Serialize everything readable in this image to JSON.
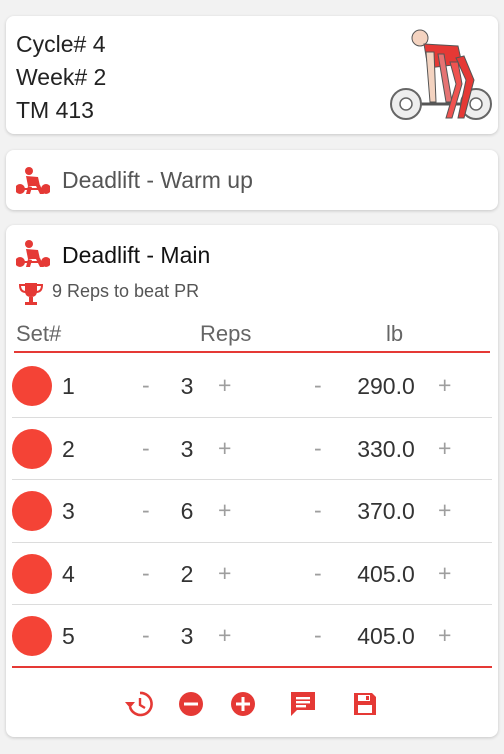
{
  "header": {
    "cycle": "Cycle# 4",
    "week": "Week# 2",
    "tm": "TM 413",
    "image_icon": "deadlift-figure-icon"
  },
  "warmup": {
    "icon": "deadlift-icon",
    "label": "Deadlift - Warm up"
  },
  "main": {
    "icon": "deadlift-icon",
    "title": "Deadlift - Main",
    "pr_icon": "trophy-icon",
    "pr_text": "9 Reps to beat PR",
    "columns": {
      "set": "Set#",
      "reps": "Reps",
      "lb": "lb"
    },
    "sets": [
      {
        "set": "1",
        "reps": "3",
        "lb": "290.0"
      },
      {
        "set": "2",
        "reps": "3",
        "lb": "330.0"
      },
      {
        "set": "3",
        "reps": "6",
        "lb": "370.0"
      },
      {
        "set": "4",
        "reps": "2",
        "lb": "405.0"
      },
      {
        "set": "5",
        "reps": "3",
        "lb": "405.0"
      }
    ],
    "minus_symbol": "-",
    "plus_symbol": "+",
    "toolbar": [
      "history-icon",
      "remove-circle-icon",
      "add-circle-icon",
      "comment-icon",
      "save-icon"
    ]
  },
  "colors": {
    "accent": "#f44336",
    "divider": "#e53935"
  }
}
